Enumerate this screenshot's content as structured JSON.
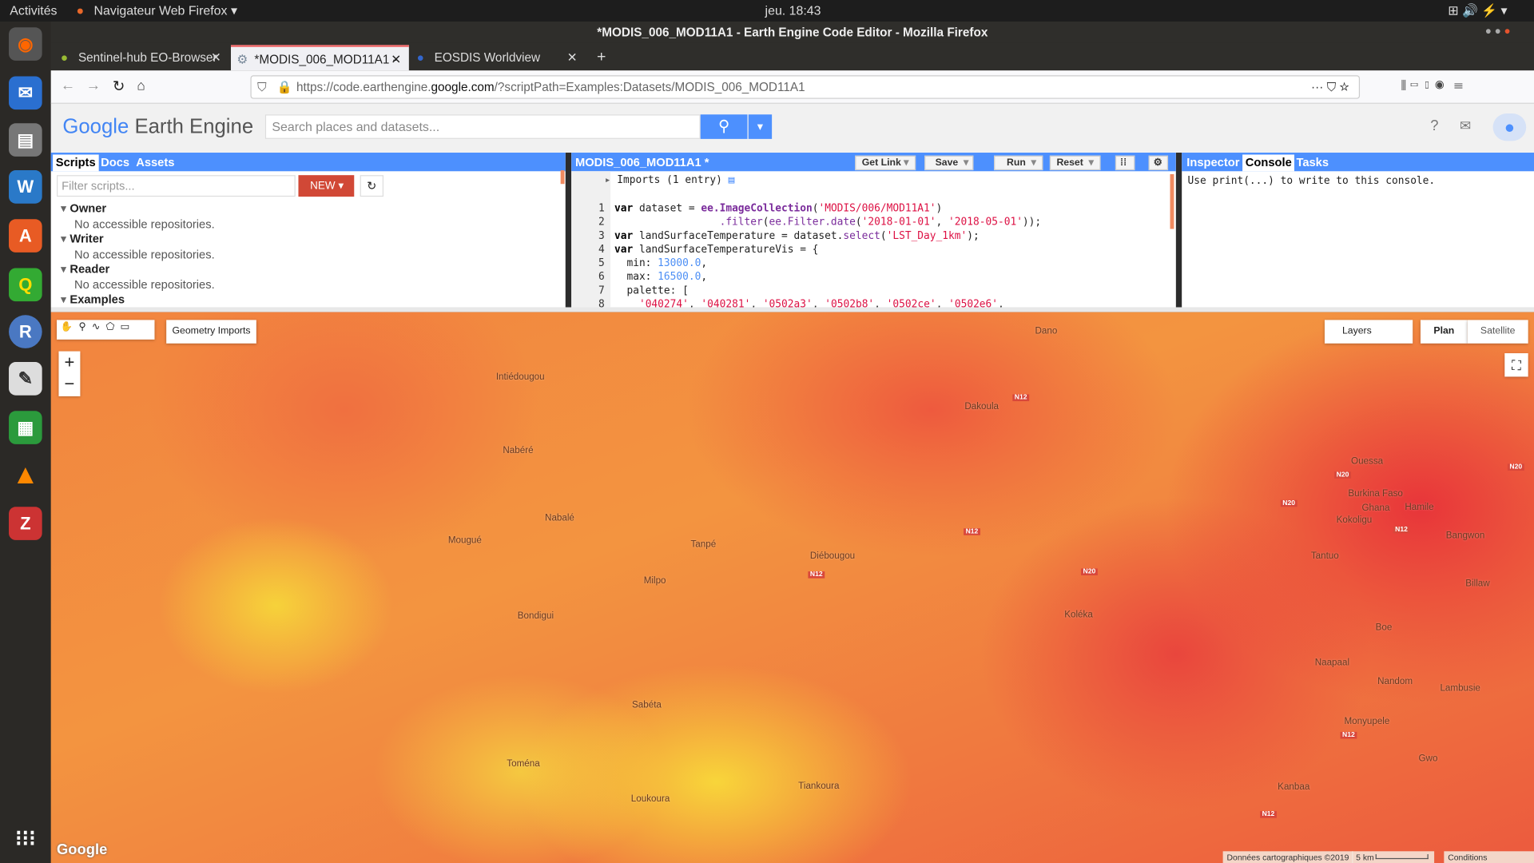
{
  "os": {
    "activities": "Activités",
    "app_menu": "Navigateur Web Firefox",
    "clock": "jeu. 18:43",
    "dock": [
      "firefox-icon",
      "thunderbird-icon",
      "files-icon",
      "writer-icon",
      "app-center-icon",
      "qgis-icon",
      "r-icon",
      "text-editor-icon",
      "calc-icon",
      "vlc-icon",
      "zotero-icon",
      "app-grid-icon"
    ]
  },
  "window": {
    "title": "*MODIS_006_MOD11A1 - Earth Engine Code Editor - Mozilla Firefox"
  },
  "tabs": [
    {
      "label": "Sentinel-hub EO-Browser"
    },
    {
      "label": "*MODIS_006_MOD11A1 -"
    },
    {
      "label": "EOSDIS Worldview"
    }
  ],
  "url": {
    "prefix": "https://code.earthengine.",
    "domain": "google.com",
    "rest": "/?scriptPath=Examples:Datasets/MODIS_006_MOD11A1"
  },
  "ee": {
    "logo_google": "Google",
    "logo_rest": "Earth Engine",
    "search_placeholder": "Search places and datasets..."
  },
  "left_panel": {
    "tabs": [
      "Scripts",
      "Docs",
      "Assets"
    ],
    "filter_placeholder": "Filter scripts...",
    "new_label": "NEW",
    "groups": [
      {
        "name": "Owner",
        "note": "No accessible repositories."
      },
      {
        "name": "Writer",
        "note": "No accessible repositories."
      },
      {
        "name": "Reader",
        "note": "No accessible repositories."
      },
      {
        "name": "Examples",
        "note": ""
      }
    ]
  },
  "editor": {
    "title": "MODIS_006_MOD11A1 *",
    "buttons": {
      "get_link": "Get Link",
      "save": "Save",
      "run": "Run",
      "reset": "Reset"
    },
    "imports": "Imports (1 entry)"
  },
  "right_panel": {
    "tabs": [
      "Inspector",
      "Console",
      "Tasks"
    ],
    "console_text": "Use print(...) to write to this console."
  },
  "map": {
    "geometry_imports": "Geometry Imports",
    "layers": "Layers",
    "plan": "Plan",
    "satellite": "Satellite",
    "google": "Google",
    "attribution": "Données cartographiques ©2019",
    "scale": "5 km",
    "terms": "Conditions d'utilisation",
    "places": [
      "Dano",
      "Intiédougou",
      "Dakoula",
      "Nabéré",
      "Ouessa",
      "Burkina Faso",
      "Ghana",
      "Hamile",
      "Kokoligu",
      "Nabalé",
      "Mougué",
      "Tanpé",
      "Diébougou",
      "Bangwon",
      "Tantuo",
      "Milpo",
      "Billaw",
      "Bondigui",
      "Koléka",
      "Boe",
      "Naapaal",
      "Nandom",
      "Lambusie",
      "Sabéta",
      "Monyupele",
      "Toména",
      "Gwo",
      "Tiankoura",
      "Kanbaa",
      "Loukoura"
    ],
    "roads": [
      "N12",
      "N12",
      "N12",
      "N20",
      "N20",
      "N20",
      "N12",
      "N12",
      "N12",
      "N20"
    ]
  },
  "colors": {
    "accent": "#4d90fe",
    "new_button": "#d14836"
  }
}
